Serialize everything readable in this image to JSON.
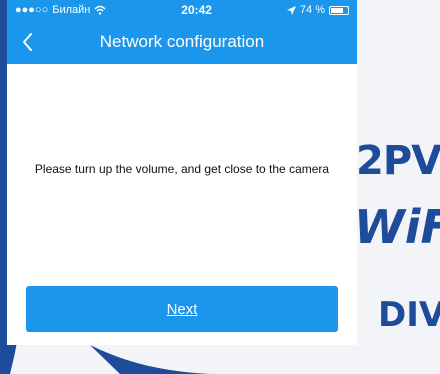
{
  "statusbar": {
    "carrier": "Билайн",
    "time": "20:42",
    "battery_percent": "74 %",
    "battery_level": 0.74
  },
  "navbar": {
    "title": "Network configuration",
    "back_icon": "chevron-left-icon"
  },
  "main": {
    "message": "Please turn up the volume, and get close to the camera",
    "next_label": "Next"
  },
  "background": {
    "brand_1": "2PV",
    "brand_2": "WiF",
    "brand_3": "DIV"
  },
  "colors": {
    "accent": "#1a96ec",
    "brand": "#1f4c9a"
  }
}
